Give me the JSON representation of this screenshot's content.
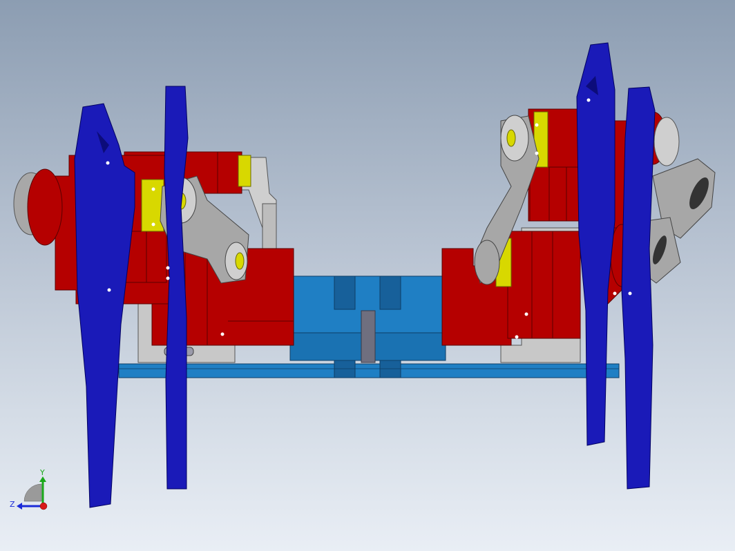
{
  "viewport": {
    "background_top": "#8c9db2",
    "background_bottom": "#e9eef5"
  },
  "model": {
    "colors": {
      "leg_blue": "#1a1ab8",
      "leg_blue_dark": "#0c0c7a",
      "servo_red": "#b50000",
      "servo_red_dark": "#7e0000",
      "bracket_gray": "#a4a4a4",
      "bracket_light": "#d6d6d6",
      "horn_yellow": "#d8d800",
      "base_blue": "#1f7fc4",
      "base_blue_dark": "#17609a",
      "standoff_gray": "#6f6f7f"
    }
  },
  "triad": {
    "x_label": "Y",
    "z_label": "Z",
    "y_axis_color": "#1aa81a",
    "z_axis_color": "#1a2ad8",
    "x_axis_color": "#d81a1a"
  }
}
